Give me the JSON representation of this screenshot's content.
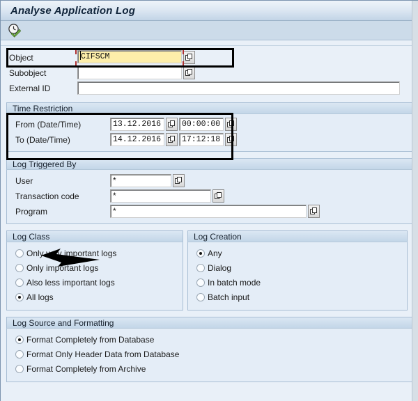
{
  "window": {
    "title": "Analyse Application Log"
  },
  "toolbar": {
    "execute_label": "Execute",
    "execute_icon": "clock-check-icon"
  },
  "selection": {
    "object": {
      "label": "Object",
      "value": "CIFSCM",
      "f4_icon": "search-help-icon",
      "focused": true
    },
    "subobject": {
      "label": "Subobject",
      "value": "",
      "f4_icon": "search-help-icon"
    },
    "external_id": {
      "label": "External ID",
      "value": ""
    }
  },
  "time_restriction": {
    "header": "Time Restriction",
    "from": {
      "label": "From (Date/Time)",
      "date": "13.12.2016",
      "time": "00:00:00",
      "date_f4_icon": "search-help-icon",
      "time_f4_icon": "search-help-icon"
    },
    "to": {
      "label": "To (Date/Time)",
      "date": "14.12.2016",
      "time": "17:12:18",
      "date_f4_icon": "search-help-icon",
      "time_f4_icon": "search-help-icon"
    }
  },
  "log_triggered_by": {
    "header": "Log Triggered By",
    "user": {
      "label": "User",
      "value": "*",
      "f4_icon": "search-help-icon"
    },
    "transaction_code": {
      "label": "Transaction code",
      "value": "*",
      "f4_icon": "search-help-icon"
    },
    "program": {
      "label": "Program",
      "value": "*",
      "f4_icon": "search-help-icon"
    }
  },
  "log_class": {
    "header": "Log Class",
    "options": [
      {
        "label": "Only very important logs",
        "selected": false
      },
      {
        "label": "Only important logs",
        "selected": false
      },
      {
        "label": "Also less important logs",
        "selected": false
      },
      {
        "label": "All logs",
        "selected": true
      }
    ]
  },
  "log_creation": {
    "header": "Log Creation",
    "options": [
      {
        "label": "Any",
        "selected": true
      },
      {
        "label": "Dialog",
        "selected": false
      },
      {
        "label": "In batch mode",
        "selected": false
      },
      {
        "label": "Batch input",
        "selected": false
      }
    ]
  },
  "log_source_and_formatting": {
    "header": "Log Source and Formatting",
    "options": [
      {
        "label": "Format Completely from Database",
        "selected": true
      },
      {
        "label": "Format Only Header Data from Database",
        "selected": false
      },
      {
        "label": "Format Completely from Archive",
        "selected": false
      }
    ]
  },
  "annotations": {
    "highlight_boxes": [
      {
        "name": "object-row-highlight"
      },
      {
        "name": "time-restriction-highlight"
      }
    ],
    "arrow": {
      "name": "pointer-arrow",
      "points_at": "Log Class"
    }
  },
  "colors": {
    "background": "#e9f0f8",
    "panel_header_top": "#dbe7f3",
    "panel_header_bottom": "#c3d6e8",
    "input_focus_yellow": "#fdeeaa",
    "focus_marker_red": "#b03030",
    "annotation_black": "#000000",
    "toolbar": "#ccdbe9"
  }
}
